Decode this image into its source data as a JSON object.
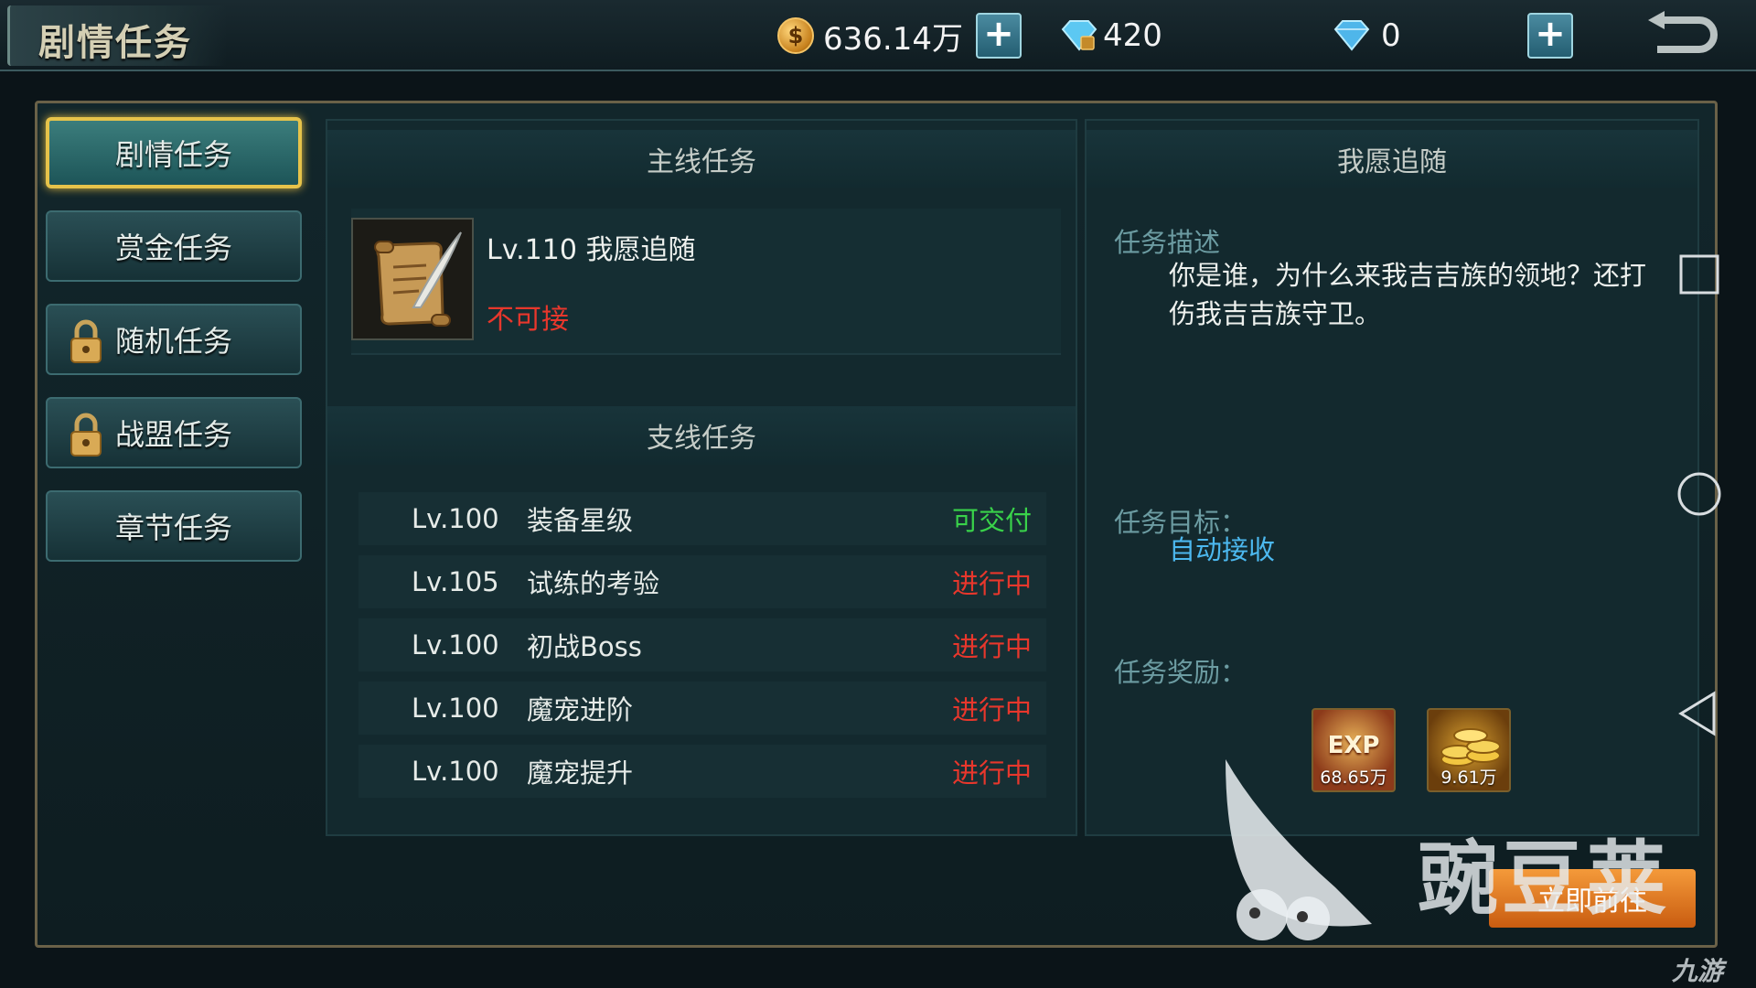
{
  "header": {
    "title": "剧情任务",
    "gold": "636.14万",
    "bound_diamond": "420",
    "diamond": "0"
  },
  "tabs": [
    {
      "label": "剧情任务",
      "locked": false,
      "active": true
    },
    {
      "label": "赏金任务",
      "locked": false,
      "active": false
    },
    {
      "label": "随机任务",
      "locked": true,
      "active": false
    },
    {
      "label": "战盟任务",
      "locked": true,
      "active": false
    },
    {
      "label": "章节任务",
      "locked": false,
      "active": false
    }
  ],
  "main_quest": {
    "header": "主线任务",
    "name": "Lv.110 我愿追随",
    "status": "不可接"
  },
  "side_quests": {
    "header": "支线任务",
    "rows": [
      {
        "level": "Lv.100",
        "name": "装备星级",
        "status": "可交付"
      },
      {
        "level": "Lv.105",
        "name": "试练的考验",
        "status": "进行中"
      },
      {
        "level": "Lv.100",
        "name": "初战Boss",
        "status": "进行中"
      },
      {
        "level": "Lv.100",
        "name": "魔宠进阶",
        "status": "进行中"
      },
      {
        "level": "Lv.100",
        "name": "魔宠提升",
        "status": "进行中"
      }
    ]
  },
  "detail": {
    "title": "我愿追随",
    "desc_label": "任务描述",
    "desc": "你是谁，为什么来我吉吉族的领地？还打伤我吉吉族守卫。",
    "target_label": "任务目标：",
    "target": "自动接收",
    "reward_label": "任务奖励：",
    "rewards": [
      {
        "icon": "exp-icon",
        "amount": "68.65万",
        "badge": "EXP"
      },
      {
        "icon": "gold-coins-icon",
        "amount": "9.61万"
      }
    ]
  },
  "go_button": "立即前往",
  "watermark": {
    "brand": "豌豆荚",
    "logo_text": "九游"
  },
  "colors": {
    "status_green": "#39d24a",
    "status_red": "#e8372c",
    "target_blue": "#4cb8ef",
    "active_tab_border": "#e6c34a"
  }
}
